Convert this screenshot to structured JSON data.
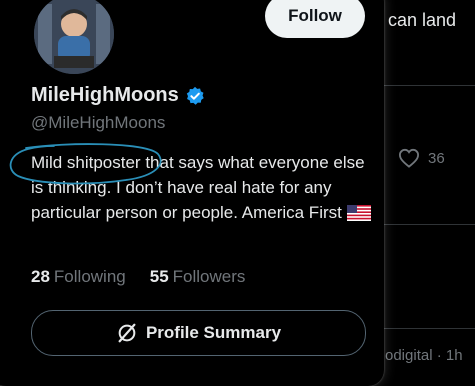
{
  "background": {
    "tweet_text": "can land",
    "like_count": "36",
    "footer_text": "odigital · 1h"
  },
  "card": {
    "follow_label": "Follow",
    "display_name": "MileHighMoons",
    "handle": "@MileHighMoons",
    "bio_line1_circled": "Mild shitposter",
    "bio_rest": " that says what everyone else is thinking. I don’t have real hate for any particular person or people. America First",
    "following_count": "28",
    "following_label": "Following",
    "followers_count": "55",
    "followers_label": "Followers",
    "summary_label": "Profile Summary",
    "verified_color": "#1d9bf0",
    "annotation_color": "#2a8fb8"
  }
}
